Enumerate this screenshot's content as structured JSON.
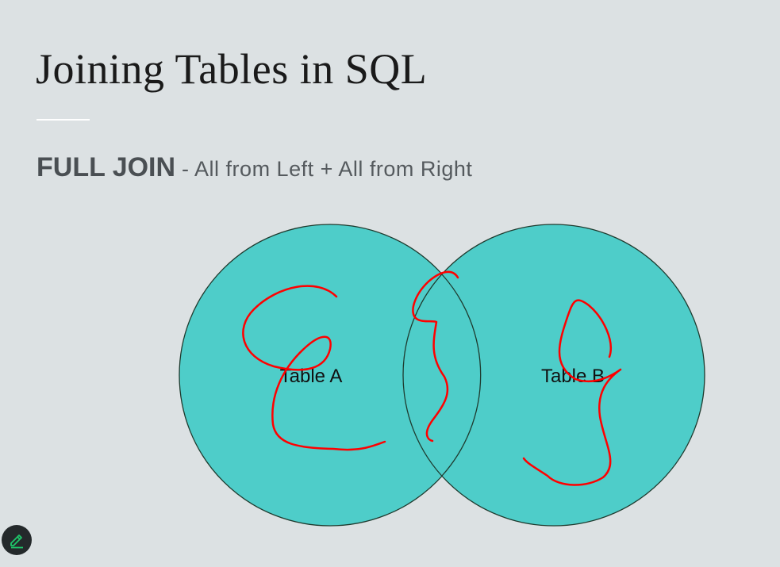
{
  "slide": {
    "title": "Joining Tables in SQL",
    "heading_bold": "FULL JOIN",
    "heading_rest": " - All from Left + All from Right"
  },
  "venn": {
    "left_label": "Table A",
    "right_label": "Table B",
    "fill_color": "#4ecdc9",
    "outline_color": "#1e3a2e",
    "annotation_color": "#ff0000"
  },
  "toolbar": {
    "pen_icon": "pencil-icon",
    "pen_color": "#1ec76a"
  }
}
